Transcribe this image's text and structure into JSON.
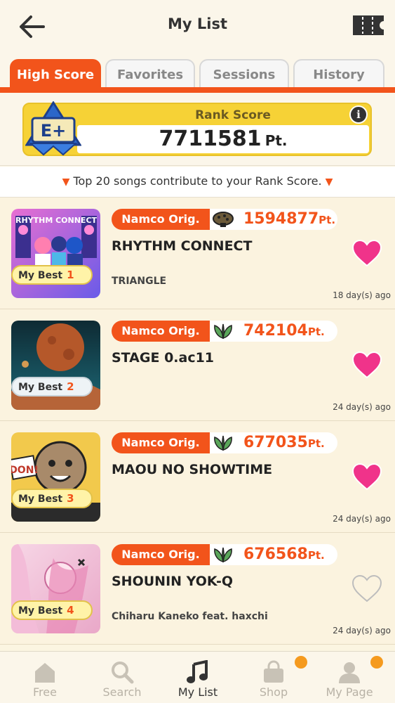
{
  "header": {
    "title": "My List"
  },
  "tabs": [
    {
      "label": "High Score",
      "active": true
    },
    {
      "label": "Favorites",
      "active": false
    },
    {
      "label": "Sessions",
      "active": false
    },
    {
      "label": "History",
      "active": false
    }
  ],
  "rank": {
    "label": "Rank Score",
    "grade": "E+",
    "value": "7711581",
    "unit": "Pt.",
    "info": "i"
  },
  "note": "Top 20 songs contribute to your Rank Score.",
  "songs": [
    {
      "category": "Namco Orig.",
      "score": "1594877",
      "unit": "Pt.",
      "title": "RHYTHM CONNECT",
      "artist": "TRIANGLE",
      "days": "18 day(s) ago",
      "mybest_label": "My Best",
      "rank": "1",
      "favorite": true,
      "jacket_text": "RHYTHM CONNECT",
      "difficulty_icon": "mushroom-icon"
    },
    {
      "category": "Namco Orig.",
      "score": "742104",
      "unit": "Pt.",
      "title": "STAGE 0.ac11",
      "artist": "",
      "days": "24 day(s) ago",
      "mybest_label": "My Best",
      "rank": "2",
      "favorite": true,
      "difficulty_icon": "leaf-icon"
    },
    {
      "category": "Namco Orig.",
      "score": "677035",
      "unit": "Pt.",
      "title": "MAOU NO SHOWTIME",
      "artist": "",
      "days": "24 day(s) ago",
      "mybest_label": "My Best",
      "rank": "3",
      "favorite": true,
      "jacket_text": "DON!",
      "difficulty_icon": "leaf-icon"
    },
    {
      "category": "Namco Orig.",
      "score": "676568",
      "unit": "Pt.",
      "title": "SHOUNIN YOK-Q",
      "artist": "Chiharu Kaneko feat. haxchi",
      "days": "24 day(s) ago",
      "mybest_label": "My Best",
      "rank": "4",
      "favorite": false,
      "difficulty_icon": "leaf-icon"
    }
  ],
  "nav": [
    {
      "label": "Free",
      "icon": "house-icon",
      "badge": false,
      "active": false
    },
    {
      "label": "Search",
      "icon": "search-icon",
      "badge": false,
      "active": false
    },
    {
      "label": "My List",
      "icon": "music-note-icon",
      "badge": false,
      "active": true
    },
    {
      "label": "Shop",
      "icon": "shopping-bag-icon",
      "badge": true,
      "active": false
    },
    {
      "label": "My Page",
      "icon": "person-icon",
      "badge": true,
      "active": false
    }
  ],
  "colors": {
    "accent": "#f2541b",
    "heart": "#f0338a",
    "gold": "#f6d236",
    "badge": "#f59a1e"
  }
}
